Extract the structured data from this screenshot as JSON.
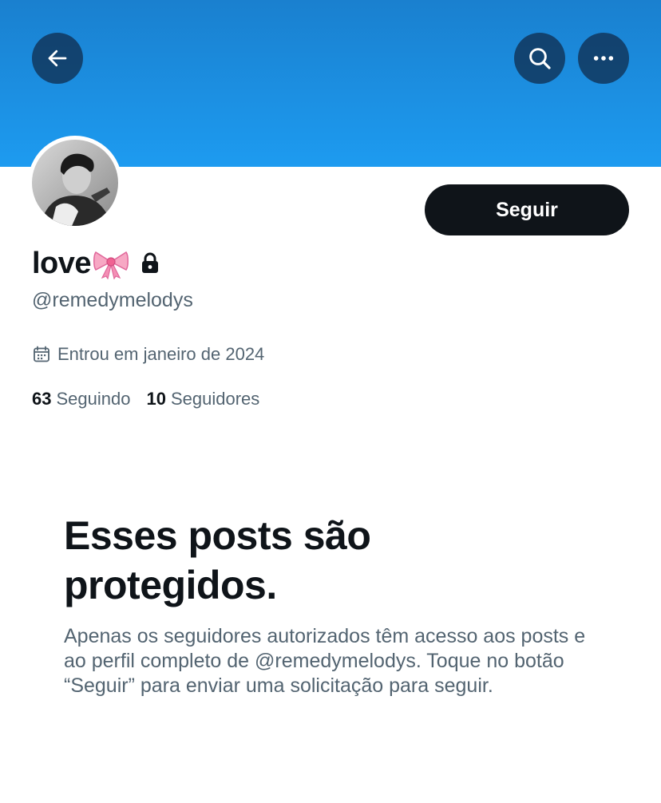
{
  "header": {
    "back_icon": "arrow-left-icon",
    "search_icon": "search-icon",
    "more_icon": "more-horizontal-icon",
    "banner_color": "#1d9bf0"
  },
  "profile": {
    "display_name": "love",
    "name_emoji": "ribbon-bow-icon",
    "locked_icon": "lock-icon",
    "handle": "@remedymelodys",
    "joined": "Entrou em janeiro de 2024",
    "following_count": "63",
    "following_label": "Seguindo",
    "followers_count": "10",
    "followers_label": "Seguidores",
    "follow_button": "Seguir"
  },
  "protected": {
    "title": "Esses posts são protegidos.",
    "body": "Apenas os seguidores autorizados têm acesso aos posts e ao perfil completo de @remedymelodys. Toque no botão “Seguir” para enviar uma solicitação para seguir."
  }
}
